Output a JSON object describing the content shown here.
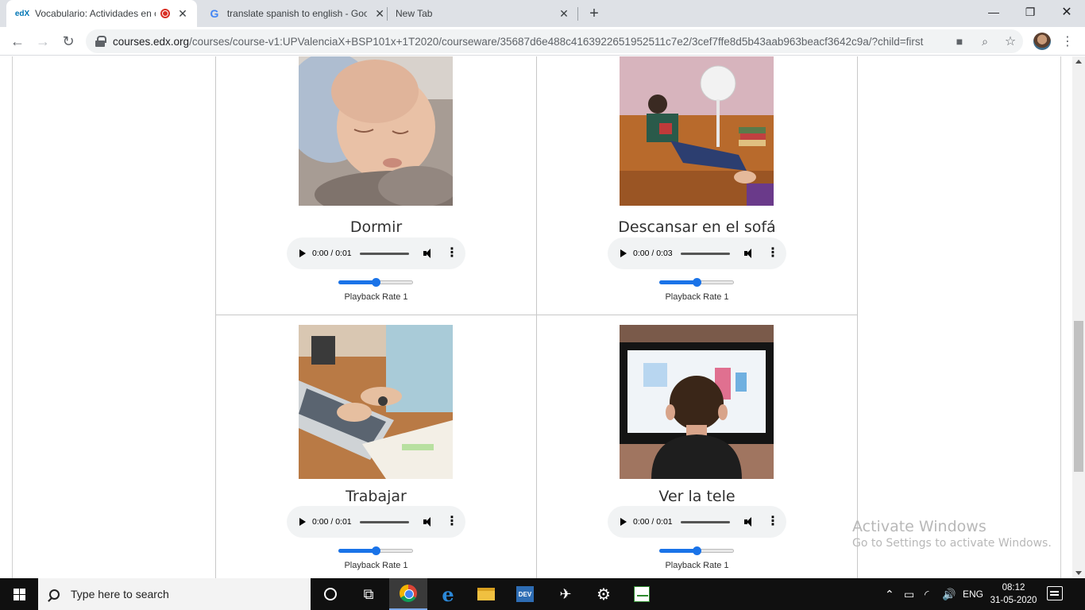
{
  "browser": {
    "tabs": [
      {
        "title": "Vocabulario: Actividades en c",
        "favicon": "edX",
        "recording": true,
        "active": true
      },
      {
        "title": "translate spanish to english - Goo",
        "favicon": "G",
        "active": false
      },
      {
        "title": "New Tab",
        "favicon": "",
        "active": false
      }
    ],
    "url_host": "courses.edx.org",
    "url_path": "/courses/course-v1:UPValenciaX+BSP101x+1T2020/courseware/35687d6e488c4163922651952511c7e2/3cef7ffe8d5b43aab963beacf3642c9a/?child=first"
  },
  "items": [
    {
      "caption": "Dormir",
      "audio_time": "0:00 / 0:01",
      "playback_rate": 1,
      "rate_label": "Playback Rate 1",
      "image": "sleeping-baby"
    },
    {
      "caption": "Descansar en el sofá",
      "audio_time": "0:00 / 0:03",
      "playback_rate": 1,
      "rate_label": "Playback Rate 1",
      "image": "boy-resting-on-sofa"
    },
    {
      "caption": "Trabajar",
      "audio_time": "0:00 / 0:01",
      "playback_rate": 1,
      "rate_label": "Playback Rate 1",
      "image": "typing-on-laptop"
    },
    {
      "caption": "Ver la tele",
      "audio_time": "0:00 / 0:01",
      "playback_rate": 1,
      "rate_label": "Playback Rate 1",
      "image": "child-watching-tv"
    }
  ],
  "watermark": {
    "title": "Activate Windows",
    "subtitle": "Go to Settings to activate Windows."
  },
  "taskbar": {
    "search_placeholder": "Type here to search",
    "language": "ENG",
    "time": "08:12",
    "date": "31-05-2020"
  },
  "colors": {
    "accent": "#1a73e8",
    "taskbar": "#101010"
  }
}
